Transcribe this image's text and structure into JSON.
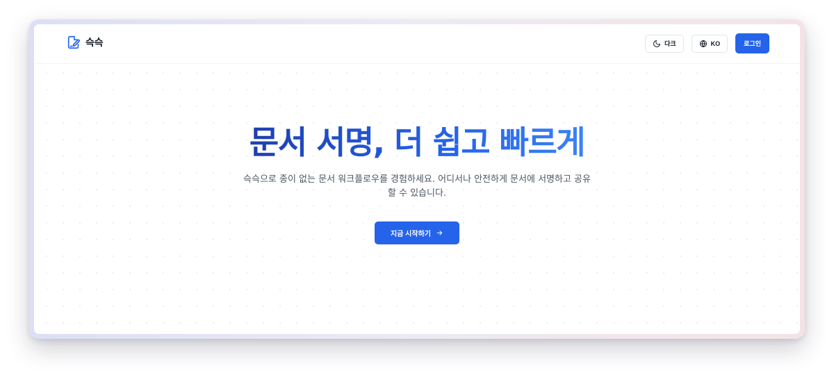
{
  "navbar": {
    "brand_name": "슥슥",
    "brand_icon": "document-pen-icon",
    "theme_toggle": {
      "icon": "moon-icon",
      "label": "다크"
    },
    "language_toggle": {
      "icon": "globe-icon",
      "label": "KO"
    },
    "login_label": "로그인"
  },
  "hero": {
    "title": "문서 서명, 더 쉽고 빠르게",
    "subtitle": "슥슥으로 종이 없는 문서 워크플로우를 경험하세요. 어디서나 안전하게 문서에 서명하고 공유할 수 있습니다.",
    "cta_label": "지금 시작하기",
    "cta_icon": "arrow-right-icon"
  },
  "colors": {
    "accent": "#2563eb",
    "title_gradient_start": "#1e40af",
    "title_gradient_end": "#3b82f6",
    "text_primary": "#111827",
    "text_secondary": "#4b5563"
  }
}
